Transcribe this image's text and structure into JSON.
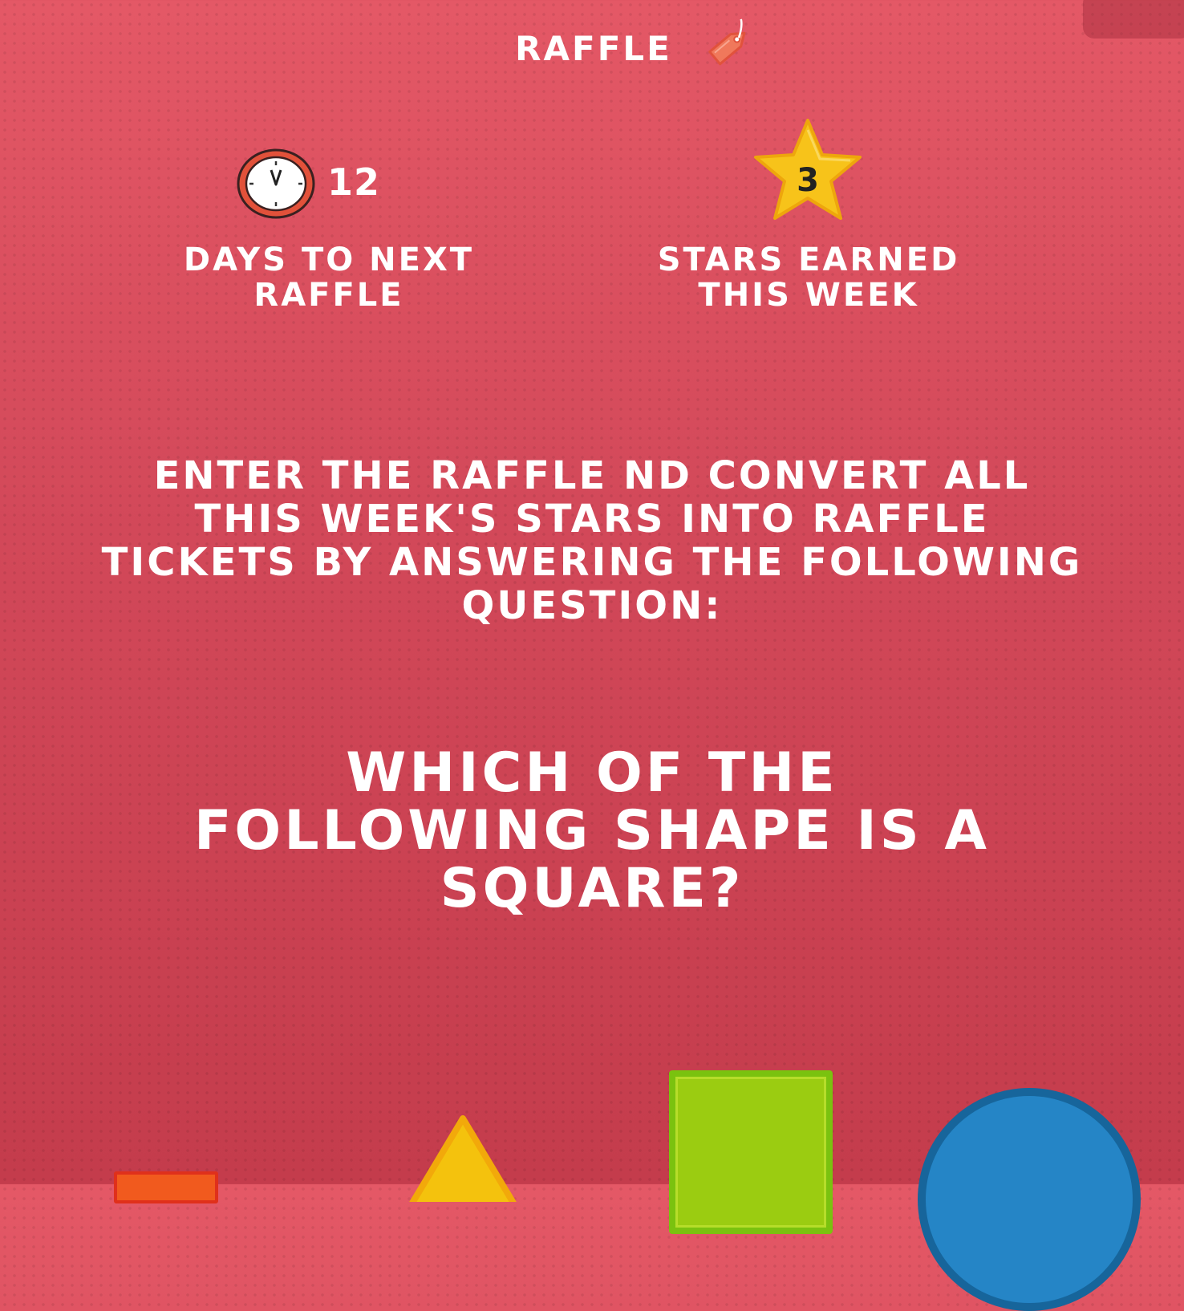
{
  "header": {
    "title": "RAFFLE",
    "tag_icon": "tag-icon"
  },
  "stats": {
    "days": {
      "value": "12",
      "label": "DAYS TO NEXT RAFFLE",
      "icon": "clock-icon"
    },
    "stars": {
      "value": "3",
      "label": "STARS EARNED THIS WEEK",
      "icon": "star-icon"
    }
  },
  "instruction": "ENTER THE RAFFLE ND CONVERT ALL THIS WEEK'S STARS INTO RAFFLE TICKETS BY ANSWERING THE FOLLOWING QUESTION:",
  "question": "WHICH OF THE FOLLOWING SHAPE IS A SQUARE?",
  "options": [
    {
      "name": "orange-square-option",
      "color": "#f15a1e"
    },
    {
      "name": "triangle-option",
      "color": "#f4c20d"
    },
    {
      "name": "square-option",
      "color": "#9bcc11"
    },
    {
      "name": "circle-option",
      "color": "#2585c6"
    }
  ],
  "colors": {
    "background": "#d24657",
    "text": "#ffffff",
    "star": "#f7c31a",
    "clock_rim": "#e2513a"
  }
}
